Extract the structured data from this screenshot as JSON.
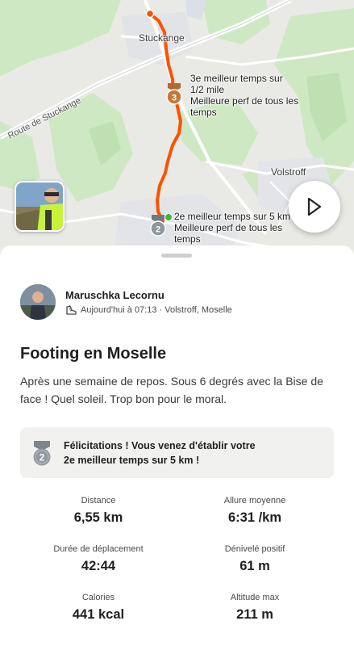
{
  "map": {
    "labels": {
      "town_stuckange": "Stuckange",
      "town_volstroff": "Volstroff",
      "road": "Route de Stuckange"
    },
    "achievement_3": {
      "badge": "3",
      "line1": "3e meilleur temps sur",
      "line2": "1/2 mile",
      "line3": "Meilleure perf de tous les",
      "line4": "temps"
    },
    "achievement_2": {
      "badge": "2",
      "line1": "2e meilleur temps sur 5 km",
      "line2": "Meilleure perf de tous les",
      "line3": "temps"
    },
    "route_color": "#fc5200"
  },
  "athlete": {
    "name": "Maruschka Lecornu",
    "meta": "Aujourd'hui à 07:13 · Volstroff, Moselle"
  },
  "activity": {
    "title": "Footing en Moselle",
    "description": "Après une semaine de repos. Sous 6 degrés avec la Bise de face ! Quel soleil. Trop bon pour le moral."
  },
  "congrats": {
    "badge": "2",
    "line1": "Félicitations ! Vous venez d'établir votre",
    "line2": "2e meilleur temps sur 5 km !"
  },
  "stats": [
    {
      "label": "Distance",
      "value": "6,55 km"
    },
    {
      "label": "Allure moyenne",
      "value": "6:31 /km"
    },
    {
      "label": "Durée de déplacement",
      "value": "42:44"
    },
    {
      "label": "Dénivelé positif",
      "value": "61 m"
    },
    {
      "label": "Calories",
      "value": "441 kcal"
    },
    {
      "label": "Altitude max",
      "value": "211 m"
    }
  ]
}
